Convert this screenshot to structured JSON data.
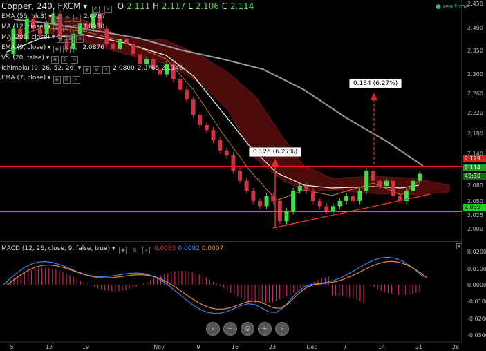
{
  "header": {
    "symbol_line": "Copper, 240, FXCM",
    "ohlc": {
      "o_label": "O",
      "o": "2.111",
      "h_label": "H",
      "h": "2.117",
      "l_label": "L",
      "l": "2.106",
      "c_label": "C",
      "c": "2.114"
    },
    "realtime": "realtime"
  },
  "indicators": [
    {
      "label": "EMA (55, hlc3)",
      "value": "2.0787",
      "value2": ""
    },
    {
      "label": "MA (12, close)",
      "value": "2.0930",
      "value2": ""
    },
    {
      "label": "MA (200, close)",
      "value": "",
      "value2": ""
    },
    {
      "label": "EMA (9, close)",
      "value": "2.0876",
      "value2": ""
    },
    {
      "label": "Vol (20, false)",
      "value": "",
      "value2": ""
    },
    {
      "label": "Ichimoku (9, 26, 52, 26)",
      "value": "2.0800",
      "value2": "2.0765  2.1146"
    },
    {
      "label": "EMA (7, close)",
      "value": "",
      "value2": ""
    }
  ],
  "macd": {
    "label": "MACD (12, 26, close, 9, false, true)",
    "v1": "0.0085",
    "v2": "0.0092",
    "v3": "0.0007"
  },
  "callouts": {
    "first": "0.126 (6.27%)",
    "second": "0.134 (6.27%)"
  },
  "price_axis": [
    "2.450",
    "2.400",
    "2.350",
    "2.300",
    "2.260",
    "2.220",
    "2.180",
    "2.140",
    "2.080",
    "2.050",
    "2.025",
    "2.000"
  ],
  "price_boxes": {
    "resistance": "2.129",
    "last": "2.114",
    "countdown": "49:30",
    "support": "2.039"
  },
  "macd_axis": [
    "0.0200",
    "0.0100",
    "0.0000",
    "-0.0100",
    "-0.0200",
    "-0.0300"
  ],
  "time_axis": [
    "5",
    "12",
    "19",
    "Nov",
    "9",
    "16",
    "23",
    "Dec",
    "7",
    "14",
    "21",
    "28"
  ],
  "nav_buttons": [
    "‹",
    "−",
    "◎",
    "+",
    "›"
  ],
  "colors": {
    "up": "#44dd44",
    "down": "#cc3344",
    "resistance": "#ff2222",
    "support": "#22dd22",
    "ma200": "#9a9a9a",
    "cloud": "#5a0f0f",
    "macd_line": "#3388ee",
    "signal_line": "#ee8822",
    "hist": "#cc2266"
  },
  "chart_data": {
    "type": "candlestick",
    "price_scale": {
      "min": 2.0,
      "max": 2.45
    },
    "resistance_level": 2.129,
    "support_level": 2.039,
    "close_series": [
      2.35,
      2.4,
      2.38,
      2.42,
      2.4,
      2.39,
      2.41,
      2.43,
      2.38,
      2.36,
      2.39,
      2.41,
      2.4,
      2.43,
      2.4,
      2.37,
      2.36,
      2.38,
      2.37,
      2.35,
      2.33,
      2.34,
      2.32,
      2.31,
      2.33,
      2.3,
      2.28,
      2.26,
      2.23,
      2.21,
      2.2,
      2.18,
      2.16,
      2.15,
      2.12,
      2.1,
      2.08,
      2.06,
      2.05,
      2.07,
      2.06,
      2.02,
      2.04,
      2.08,
      2.09,
      2.08,
      2.06,
      2.05,
      2.04,
      2.05,
      2.06,
      2.07,
      2.06,
      2.08,
      2.12,
      2.1,
      2.09,
      2.1,
      2.07,
      2.06,
      2.08,
      2.1,
      2.114
    ],
    "macd_range": {
      "min": -0.03,
      "max": 0.02
    }
  }
}
